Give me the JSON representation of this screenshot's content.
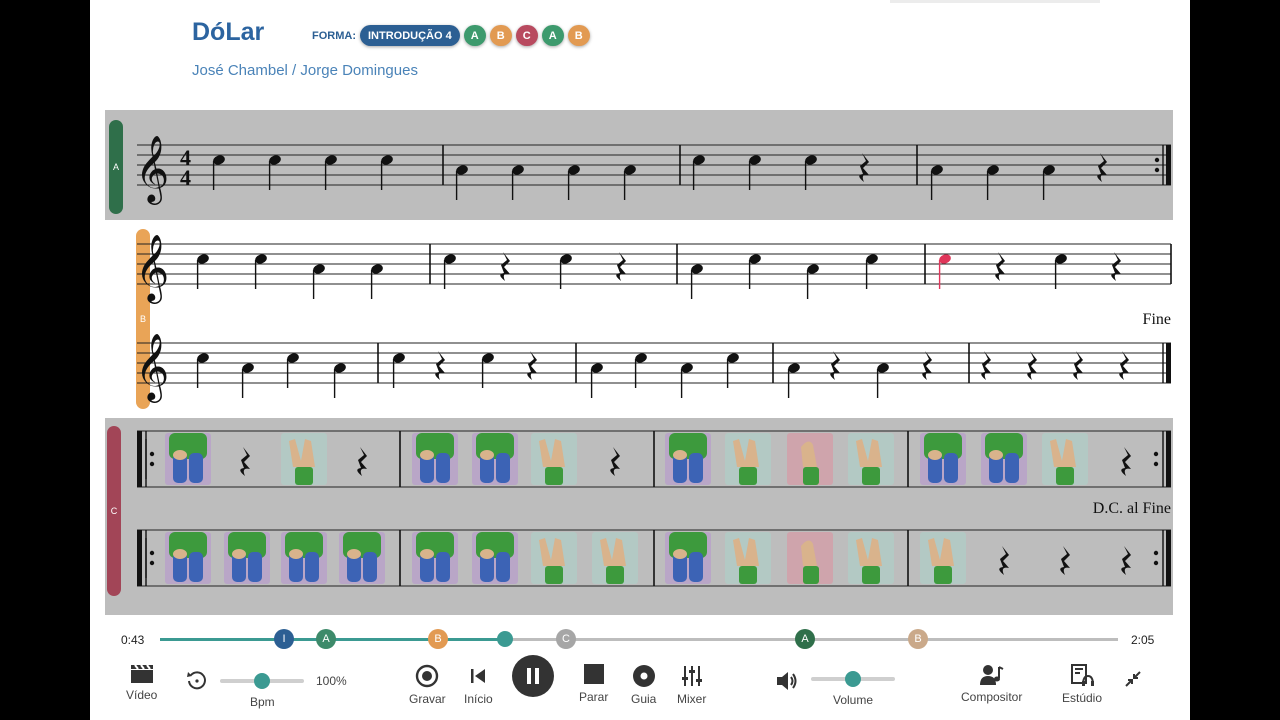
{
  "song": {
    "title": "DóLar",
    "composers": "José Chambel / Jorge Domingues",
    "forma_label": "FORMA:",
    "forma": [
      {
        "label": "INTRODUÇÃO 4",
        "color": "#2c5f93"
      },
      {
        "label": "A",
        "color": "#3d9a6d"
      },
      {
        "label": "B",
        "color": "#e29a52"
      },
      {
        "label": "C",
        "color": "#b84a5f"
      },
      {
        "label": "A",
        "color": "#3d9a6d"
      },
      {
        "label": "B",
        "color": "#e29a52"
      }
    ]
  },
  "sections": {
    "a": {
      "label": "A",
      "color": "#2f6f4a"
    },
    "b": {
      "label": "B",
      "color": "#e9a457"
    },
    "c": {
      "label": "C",
      "color": "#a24557"
    }
  },
  "score": {
    "fine": "Fine",
    "dc_al_fine": "D.C. al Fine",
    "time_signature": "4/4"
  },
  "player": {
    "elapsed": "0:43",
    "total": "2:05",
    "progress": 0.36,
    "markers": [
      {
        "label": "I",
        "color": "#2c5f93"
      },
      {
        "label": "A",
        "color": "#3d8a6a"
      },
      {
        "label": "B",
        "color": "#e29a52"
      },
      {
        "label": "C",
        "color": "#a6a6a6"
      },
      {
        "label": "A",
        "color": "#2f6f4a"
      },
      {
        "label": "B",
        "color": "#caa98a"
      }
    ],
    "bpm_value": "100%",
    "bpm_slider": 0.5,
    "volume_slider": 0.5,
    "labels": {
      "video": "Vídeo",
      "bpm": "Bpm",
      "record": "Gravar",
      "start": "Início",
      "stop": "Parar",
      "guide": "Guia",
      "mixer": "Mixer",
      "volume": "Volume",
      "composer": "Compositor",
      "studio": "Estúdio"
    },
    "icons": {
      "video": "clapperboard-icon",
      "reset": "reset-icon",
      "record": "record-icon",
      "start": "skip-back-icon",
      "pause": "pause-icon",
      "stop": "stop-icon",
      "guide": "disc-icon",
      "mixer": "mixer-icon",
      "volume": "speaker-icon",
      "composer": "composer-icon",
      "studio": "studio-icon",
      "collapse": "collapse-icon"
    }
  }
}
